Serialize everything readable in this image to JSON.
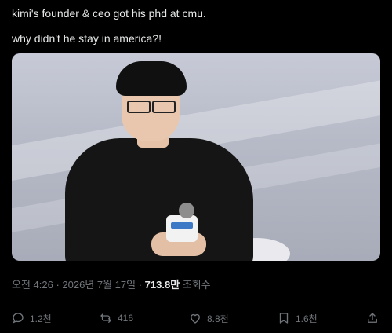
{
  "post": {
    "line1": "kimi's founder & ceo got his phd at cmu.",
    "line2": "why didn't he stay in america?!"
  },
  "meta": {
    "time_date": "오전 4:26 · 2026년 7월 17일 ·",
    "views_count": "713.8만",
    "views_label": "조회수"
  },
  "actions": {
    "replies": "1.2천",
    "reposts": "416",
    "likes": "8.8천",
    "bookmarks": "1.6천"
  },
  "colors": {
    "background": "#000000",
    "text": "#e7e9ea",
    "muted": "#71767b",
    "divider": "#2f3336"
  }
}
